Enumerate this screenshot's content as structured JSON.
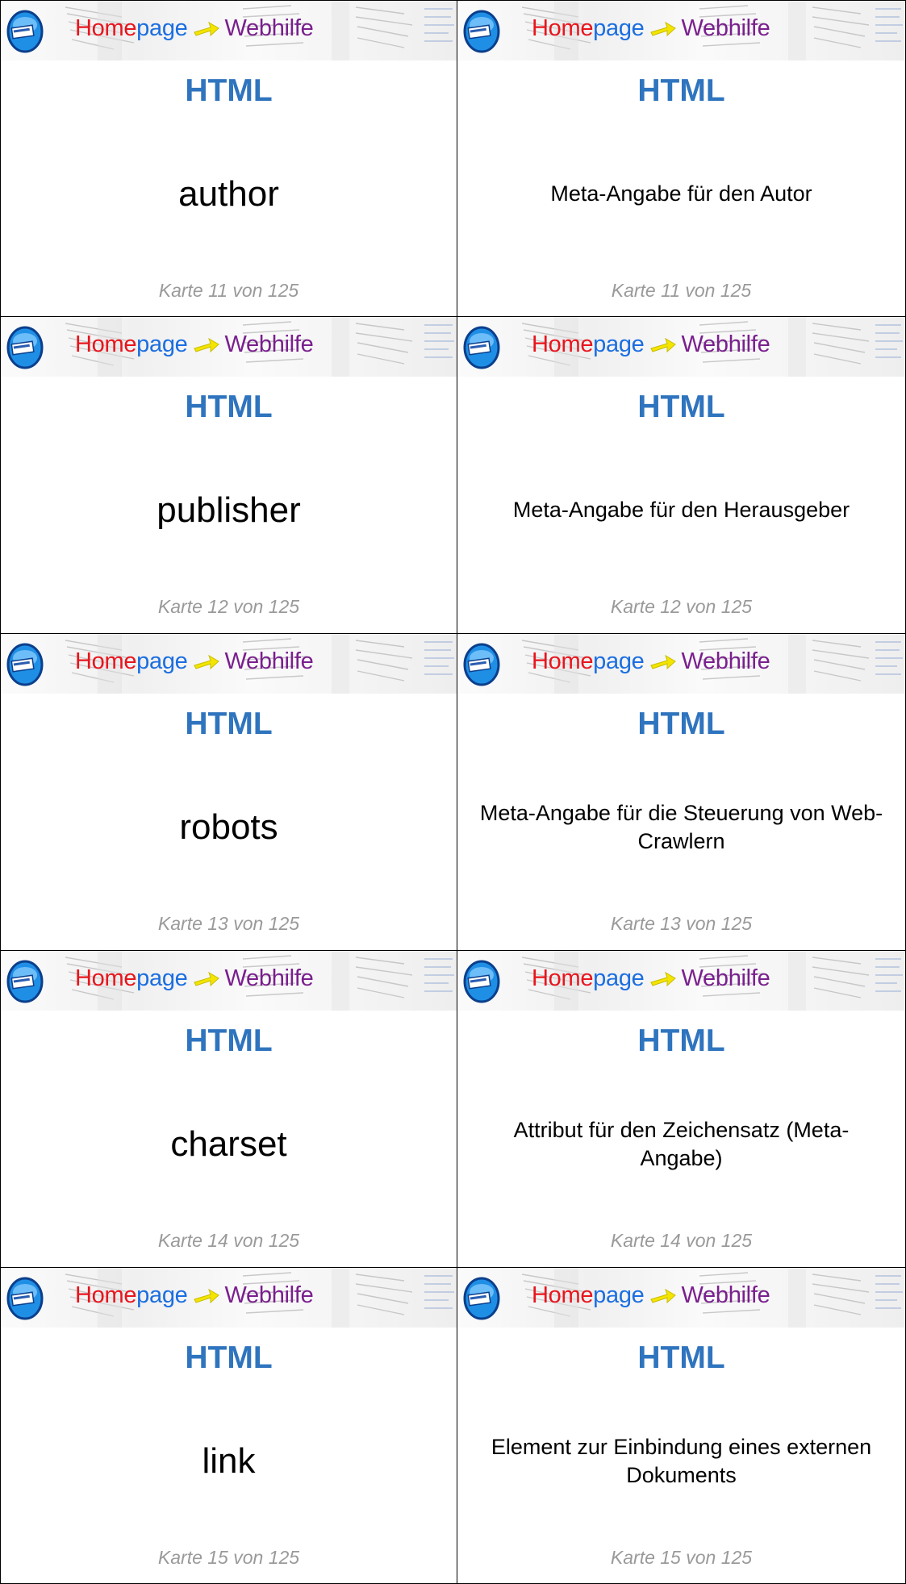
{
  "brand": {
    "part1": "Home",
    "part2": "page",
    "part3": "Webhilfe",
    "logo_icon": "homepage-logo-icon",
    "arrow_icon": "arrow-icon"
  },
  "colors": {
    "label": "#2f74be",
    "footer": "#9a9a9a",
    "home_red": "#e8151d",
    "page_blue": "#1b6ee0",
    "webhilfe_purple": "#7a1f8e"
  },
  "cards": [
    {
      "label": "HTML",
      "term": "author",
      "definition": "Meta-Angabe für den Autor",
      "footer": "Karte 11 von 125"
    },
    {
      "label": "HTML",
      "term": "publisher",
      "definition": "Meta-Angabe für den Herausgeber",
      "footer": "Karte 12 von 125"
    },
    {
      "label": "HTML",
      "term": "robots",
      "definition": "Meta-Angabe für die Steuerung von Web-Crawlern",
      "footer": "Karte 13 von 125"
    },
    {
      "label": "HTML",
      "term": "charset",
      "definition": "Attribut für den Zeichensatz (Meta-Angabe)",
      "footer": "Karte 14 von 125"
    },
    {
      "label": "HTML",
      "term": "link",
      "definition": "Element zur Einbindung eines externen Dokuments",
      "footer": "Karte 15 von 125"
    }
  ]
}
